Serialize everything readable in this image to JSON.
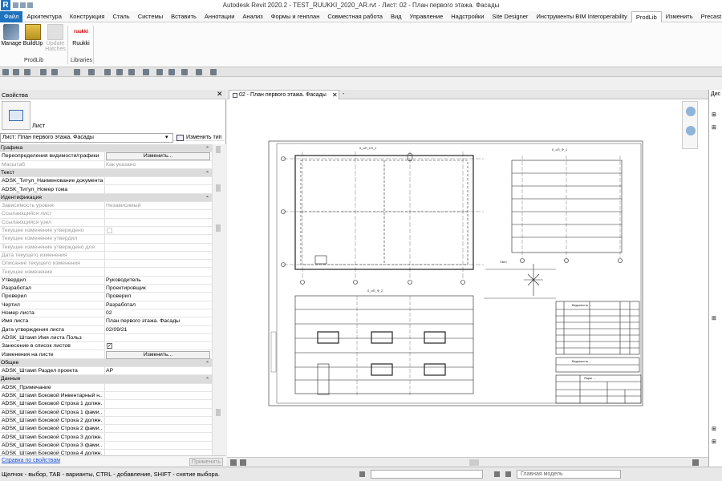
{
  "title": "Autodesk Revit 2020.2 - TEST_RUUKKI_2020_AR.rvt - Лист: 02 - План первого этажа. Фасады",
  "app_logo": "R",
  "ribbon_tabs": [
    "Файл",
    "Архитектура",
    "Конструкция",
    "Сталь",
    "Системы",
    "Вставить",
    "Аннотации",
    "Анализ",
    "Формы и генплан",
    "Совместная работа",
    "Вид",
    "Управление",
    "Надстройки",
    "Site Designer",
    "Инструменты BIM Interoperability",
    "ProdLib",
    "Изменить",
    "Precast"
  ],
  "ribbon_extra": "• ▾",
  "ribbon": {
    "buttons": [
      {
        "label": "Manage"
      },
      {
        "label": "BuildUp"
      },
      {
        "label": "Update Hatches"
      },
      {
        "label": "Ruukki",
        "logo_text": "ruukki"
      }
    ],
    "panels": [
      "ProdLib",
      "Libraries"
    ]
  },
  "properties": {
    "title": "Свойства",
    "close": "✕",
    "type_name": "Лист",
    "selector": "Лист: План первого этажа. Фасады",
    "selector_arrow": "▾",
    "edit_type": "Изменить тип",
    "rows": [
      {
        "kind": "group",
        "k": "Графика",
        "cap": "⌃"
      },
      {
        "k": "Переопределения видимости/графики",
        "btn": "Изменить..."
      },
      {
        "k": "Масштаб",
        "v": "Как указано",
        "dim": true
      },
      {
        "kind": "group",
        "k": "Текст",
        "cap": "⌃"
      },
      {
        "k": "ADSK_Титул_Наименование документа",
        "v": ""
      },
      {
        "k": "ADSK_Титул_Номер тома",
        "v": ""
      },
      {
        "kind": "group",
        "k": "Идентификация",
        "cap": "⌃"
      },
      {
        "k": "Зависимость уровня",
        "v": "Независимый",
        "dim": true
      },
      {
        "k": "Ссылающийся лист",
        "v": "",
        "dim": true
      },
      {
        "k": "Ссылающийся узел",
        "v": "",
        "dim": true
      },
      {
        "k": "Текущее изменение утверждено",
        "check": "",
        "dim": true
      },
      {
        "k": "Текущее изменение утвердил",
        "v": "",
        "dim": true
      },
      {
        "k": "Текущее изменение утверждено для",
        "v": "",
        "dim": true
      },
      {
        "k": "Дата текущего изменения",
        "v": "",
        "dim": true
      },
      {
        "k": "Описание текущего изменения",
        "v": "",
        "dim": true
      },
      {
        "k": "Текущее изменение",
        "v": "",
        "dim": true
      },
      {
        "k": "Утвердил",
        "v": "Руководитель"
      },
      {
        "k": "Разработал",
        "v": "Проектировщик"
      },
      {
        "k": "Проверил",
        "v": "Проверил"
      },
      {
        "k": "Чертил",
        "v": "Разработал"
      },
      {
        "k": "Номер листа",
        "v": "02"
      },
      {
        "k": "Имя листа",
        "v": "План первого этажа. Фасады"
      },
      {
        "k": "Дата утверждения листа",
        "v": "02/09/21"
      },
      {
        "k": "ADSK_Штамп Имя листа Польз",
        "v": ""
      },
      {
        "k": "Занесение в список листов",
        "check": "✓"
      },
      {
        "k": "Изменения на листе",
        "btn": "Изменить..."
      },
      {
        "kind": "group",
        "k": "Общие",
        "cap": "⌃"
      },
      {
        "k": "ADSK_Штамп Раздел проекта",
        "v": "АР"
      },
      {
        "kind": "group",
        "k": "Данные",
        "cap": "⌃"
      },
      {
        "k": "ADSK_Примечание",
        "v": ""
      },
      {
        "k": "ADSK_Штамп Боковой Инвентарный н...",
        "v": ""
      },
      {
        "k": "ADSK_Штамп Боковой Строка 1 должн...",
        "v": ""
      },
      {
        "k": "ADSK_Штамп Боковой Строка 1 фами...",
        "v": ""
      },
      {
        "k": "ADSK_Штамп Боковой Строка 2 должн...",
        "v": ""
      },
      {
        "k": "ADSK_Штамп Боковой Строка 2 фами...",
        "v": ""
      },
      {
        "k": "ADSK_Штамп Боковой Строка 3 должн...",
        "v": ""
      },
      {
        "k": "ADSK_Штамп Боковой Строка 3 фами...",
        "v": ""
      },
      {
        "k": "ADSK_Штамп Боковой Строка 4 должн...",
        "v": ""
      }
    ],
    "help_link": "Справка по свойствам",
    "apply": "Применить"
  },
  "view": {
    "tab_label": "02 - План первого этажа. Фасады",
    "tab_close": "✕",
    "tab2_label": "-",
    "sheet": {
      "plan_title": "0_оП_1Э_1",
      "elev1_title": "0_оП_Ф_1",
      "elev2_title": "0_оП_Ф_2",
      "table1_title": "Ведомость...",
      "table2_title": "Ведомость...",
      "stamp_text": "Ящик ...",
      "node_label": "Узел"
    }
  },
  "browser": {
    "title": "Дис"
  },
  "status": {
    "text": "Щелчок - выбор, TAB - варианты, CTRL - добавление, SHIFT - снятие выбора.",
    "model": "Главная модель"
  }
}
